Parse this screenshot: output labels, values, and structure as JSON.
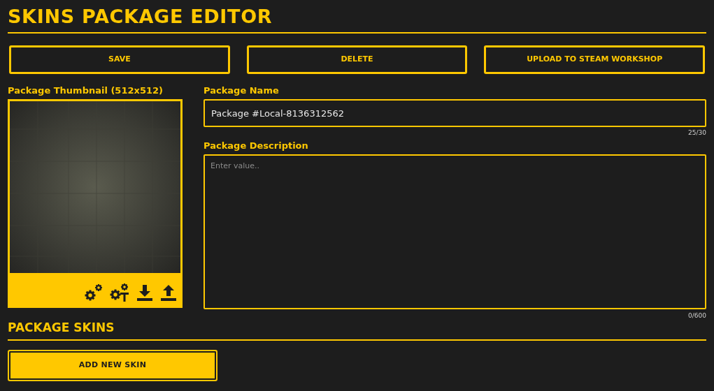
{
  "title": "SKINS PACKAGE EDITOR",
  "actions": [
    {
      "label": "SAVE"
    },
    {
      "label": "DELETE"
    },
    {
      "label": "UPLOAD TO STEAM WORKSHOP"
    }
  ],
  "thumbnail": {
    "label": "Package Thumbnail (512x512)",
    "tools": [
      {
        "kind": "gears"
      },
      {
        "kind": "gears-text"
      },
      {
        "kind": "download"
      },
      {
        "kind": "upload"
      }
    ]
  },
  "name_field": {
    "label": "Package Name",
    "value": "Package #Local-8136312562",
    "counter": "25/30"
  },
  "description_field": {
    "label": "Package Description",
    "placeholder": "Enter value..",
    "counter": "0/600"
  },
  "skins_section": {
    "title": "PACKAGE SKINS",
    "add_button": "ADD NEW SKIN"
  }
}
